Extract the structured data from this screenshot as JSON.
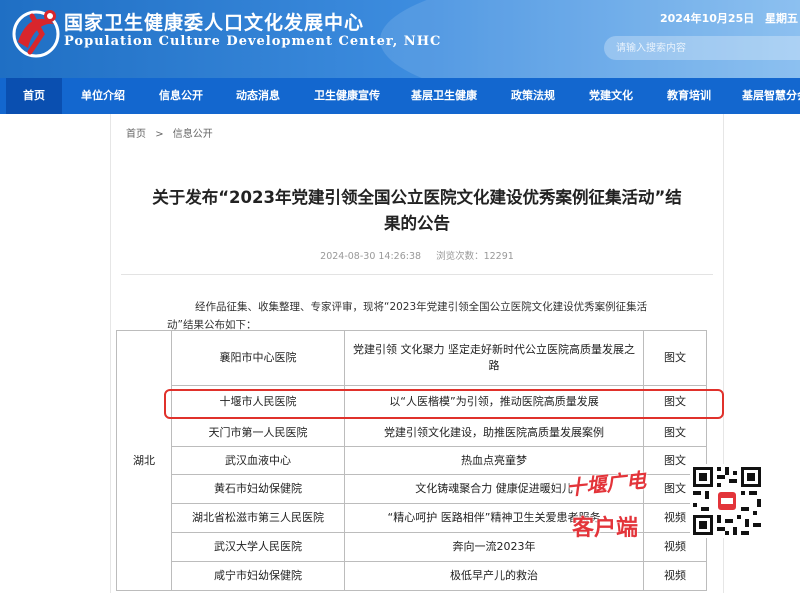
{
  "site": {
    "name_cn": "国家卫生健康委人口文化发展中心",
    "name_en": "Population Culture Development Center, NHC",
    "date": "2024年10月25日",
    "weekday": "星期五",
    "search_placeholder": "请输入搜索内容"
  },
  "nav": [
    {
      "label": "首页",
      "active": true
    },
    {
      "label": "单位介绍"
    },
    {
      "label": "信息公开"
    },
    {
      "label": "动态消息"
    },
    {
      "label": "卫生健康宣传"
    },
    {
      "label": "基层卫生健康"
    },
    {
      "label": "政策法规"
    },
    {
      "label": "党建文化"
    },
    {
      "label": "教育培训"
    },
    {
      "label": "基层智慧分会"
    }
  ],
  "breadcrumb": {
    "home": "首页",
    "sep": ">",
    "current": "信息公开"
  },
  "article": {
    "title_line1": "关于发布“2023年党建引领全国公立医院文化建设优秀案例征集活动”结",
    "title_line2": "果的公告",
    "date": "2024-08-30 14:26:38",
    "views": "浏览次数：12291",
    "intro": "经作品征集、收集整理、专家评审，现将“2023年党建引领全国公立医院文化建设优秀案例征集活动”结果公布如下："
  },
  "table": {
    "province": "湖北",
    "rows": [
      {
        "hospital": "襄阳市中心医院",
        "title": "党建引领 文化聚力 坚定走好新时代公立医院高质量发展之路",
        "type": "图文"
      },
      {
        "hospital": "十堰市人民医院",
        "title": "以“人医楷模”为引领，推动医院高质量发展",
        "type": "图文"
      },
      {
        "hospital": "天门市第一人民医院",
        "title": "党建引领文化建设，助推医院高质量发展案例",
        "type": "图文"
      },
      {
        "hospital": "武汉血液中心",
        "title": "热血点亮童梦",
        "type": "图文"
      },
      {
        "hospital": "黄石市妇幼保健院",
        "title": "文化铸魂聚合力 健康促进暖妇儿",
        "type": "图文"
      },
      {
        "hospital": "湖北省松滋市第三人民医院",
        "title": "“精心呵护 医路相伴”精神卫生关爱患者服务",
        "type": "视频"
      },
      {
        "hospital": "武汉大学人民医院",
        "title": "奔向一流2023年",
        "type": "视频"
      },
      {
        "hospital": "咸宁市妇幼保健院",
        "title": "极低早产儿的救治",
        "type": "视频"
      }
    ]
  },
  "watermark": {
    "line1": "十堰广电",
    "line2": "客户端"
  },
  "colors": {
    "header": "#2a7cd2",
    "nav": "#1367cf",
    "nav_active": "#0a4fb0",
    "highlight": "#e0312b",
    "watermark": "#e3343a"
  }
}
